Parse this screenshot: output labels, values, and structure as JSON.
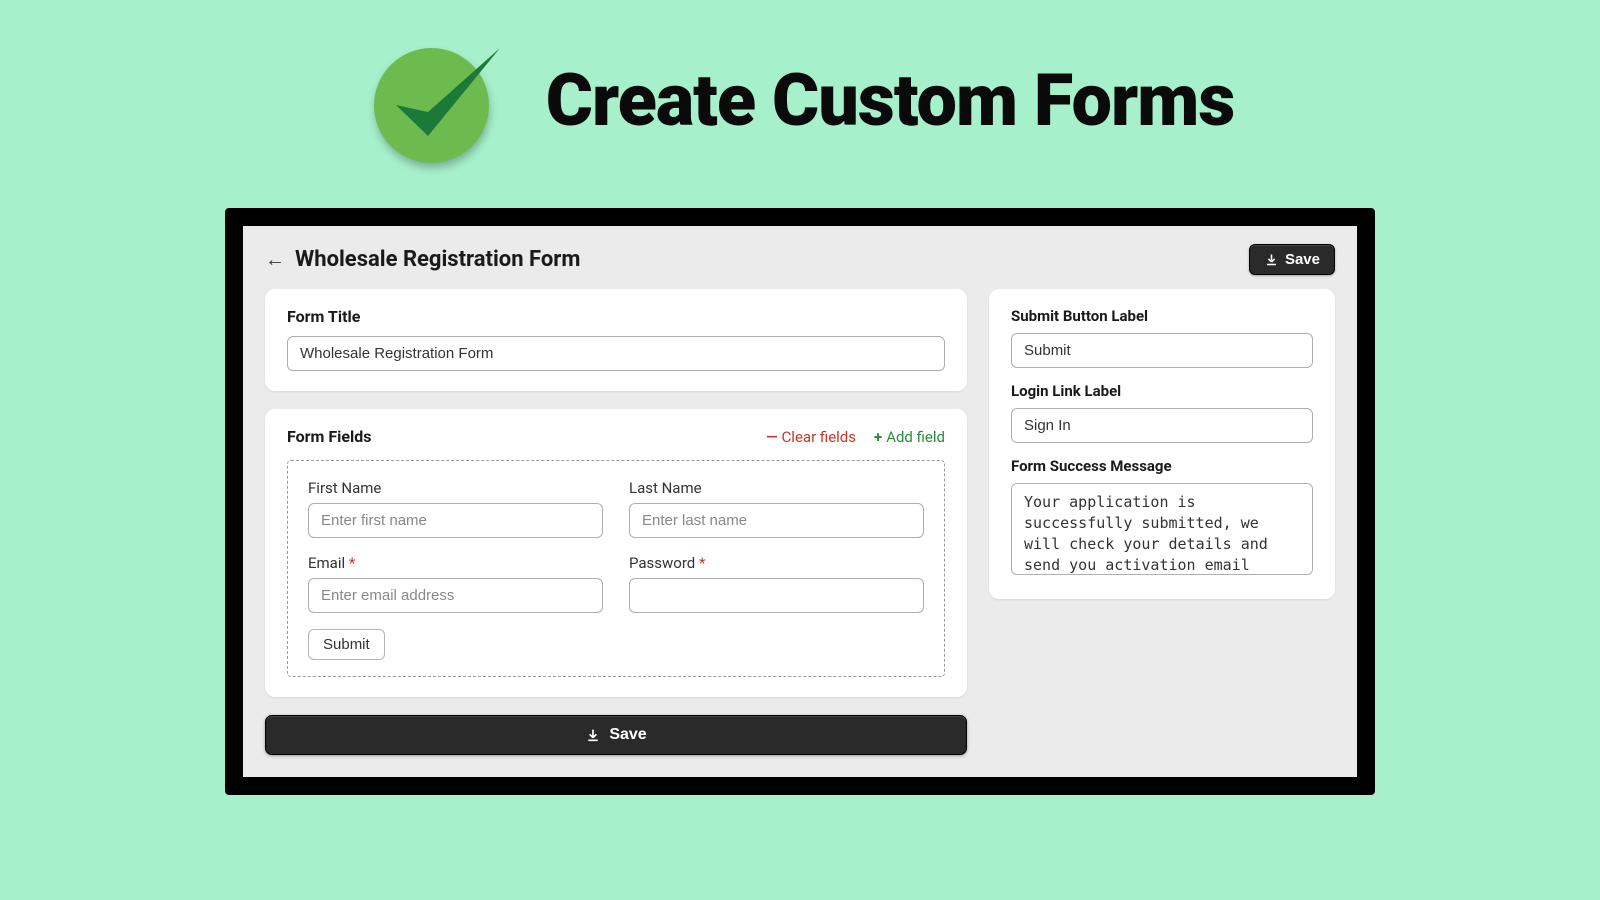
{
  "hero": {
    "title": "Create Custom Forms"
  },
  "topbar": {
    "page_title": "Wholesale Registration Form",
    "save_label": "Save"
  },
  "form_title_section": {
    "label": "Form Title",
    "value": "Wholesale Registration Form"
  },
  "form_fields_section": {
    "label": "Form Fields",
    "clear_label": "Clear fields",
    "add_label": "Add field",
    "fields": [
      {
        "label": "First Name",
        "placeholder": "Enter first name",
        "required": false
      },
      {
        "label": "Last Name",
        "placeholder": "Enter last name",
        "required": false
      },
      {
        "label": "Email",
        "placeholder": "Enter email address",
        "required": true
      },
      {
        "label": "Password",
        "placeholder": "",
        "required": true
      }
    ],
    "submit_preview_label": "Submit"
  },
  "bottom_save": {
    "label": "Save"
  },
  "sidebar": {
    "submit_button": {
      "label": "Submit Button Label",
      "value": "Submit"
    },
    "login_link": {
      "label": "Login Link Label",
      "value": "Sign In"
    },
    "success_msg": {
      "label": "Form Success Message",
      "value": "Your application is successfully submitted, we will check your details and send you activation email soon. It can take few days"
    }
  }
}
